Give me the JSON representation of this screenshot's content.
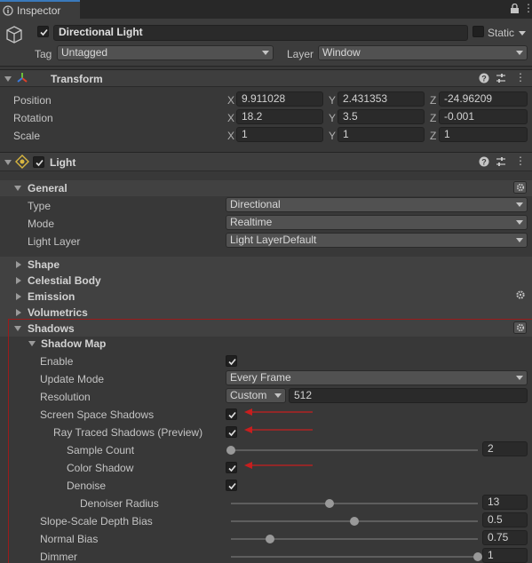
{
  "window": {
    "tab_title": "Inspector"
  },
  "object": {
    "name": "Directional Light",
    "static_label": "Static",
    "tag_label": "Tag",
    "tag_value": "Untagged",
    "layer_label": "Layer",
    "layer_value": "Window"
  },
  "transform": {
    "title": "Transform",
    "position": {
      "label": "Position",
      "x": "9.911028",
      "y": "2.431353",
      "z": "-24.96209"
    },
    "rotation": {
      "label": "Rotation",
      "x": "18.2",
      "y": "3.5",
      "z": "-0.001"
    },
    "scale": {
      "label": "Scale",
      "x": "1",
      "y": "1",
      "z": "1"
    },
    "axes": {
      "x": "X",
      "y": "Y",
      "z": "Z"
    }
  },
  "light": {
    "title": "Light",
    "general": {
      "title": "General",
      "type_label": "Type",
      "type_value": "Directional",
      "mode_label": "Mode",
      "mode_value": "Realtime",
      "layer_label": "Light Layer",
      "layer_value": "Light LayerDefault"
    },
    "sections": [
      "Shape",
      "Celestial Body",
      "Emission",
      "Volumetrics"
    ],
    "shadows": {
      "title": "Shadows",
      "shadow_map": "Shadow Map",
      "enable_label": "Enable",
      "update_mode_label": "Update Mode",
      "update_mode_value": "Every Frame",
      "resolution_label": "Resolution",
      "resolution_preset": "Custom",
      "resolution_value": "512",
      "screen_space_label": "Screen Space Shadows",
      "ray_traced_label": "Ray Traced Shadows (Preview)",
      "sample_count_label": "Sample Count",
      "sample_count_value": "2",
      "color_shadow_label": "Color Shadow",
      "denoise_label": "Denoise",
      "denoiser_radius_label": "Denoiser Radius",
      "denoiser_radius_value": "13",
      "slope_label": "Slope-Scale Depth Bias",
      "slope_value": "0.5",
      "normal_label": "Normal Bias",
      "normal_value": "0.75",
      "dimmer_label": "Dimmer",
      "dimmer_value": "1"
    }
  },
  "sliders": {
    "sample_count": 0.0,
    "denoiser_radius": 0.4,
    "slope": 0.5,
    "normal": 0.16,
    "dimmer": 1.0
  },
  "colors": {
    "annotation": "#c81e1e",
    "accent": "#3a79bb"
  }
}
